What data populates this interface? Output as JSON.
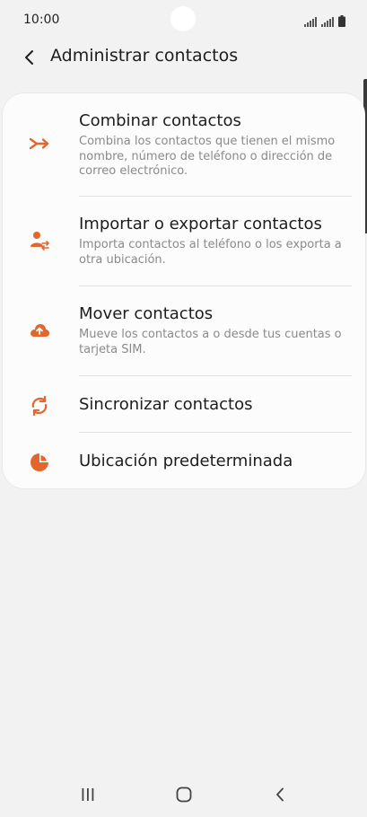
{
  "status_bar": {
    "time": "10:00",
    "icons": [
      "wifi-signal-icon",
      "cell-signal-icon",
      "battery-icon"
    ]
  },
  "header": {
    "back_icon": "chevron-left-icon",
    "title": "Administrar contactos"
  },
  "accent_color": "#e2672c",
  "items": [
    {
      "icon": "merge-arrows-icon",
      "title": "Combinar contactos",
      "description": "Combina los contactos que tienen el mismo nombre, número de teléfono o dirección de correo electrónico."
    },
    {
      "icon": "person-transfer-icon",
      "title": "Importar o exportar contactos",
      "description": "Importa contactos al teléfono o los exporta a otra ubicación."
    },
    {
      "icon": "cloud-upload-icon",
      "title": "Mover contactos",
      "description": "Mueve los contactos a o desde tus cuentas o tarjeta SIM."
    },
    {
      "icon": "sync-icon",
      "title": "Sincronizar contactos"
    },
    {
      "icon": "pie-chart-icon",
      "title": "Ubicación predeterminada"
    }
  ],
  "nav_bar": {
    "recents_icon": "recents-icon",
    "home_icon": "home-icon",
    "back_icon": "back-icon"
  }
}
